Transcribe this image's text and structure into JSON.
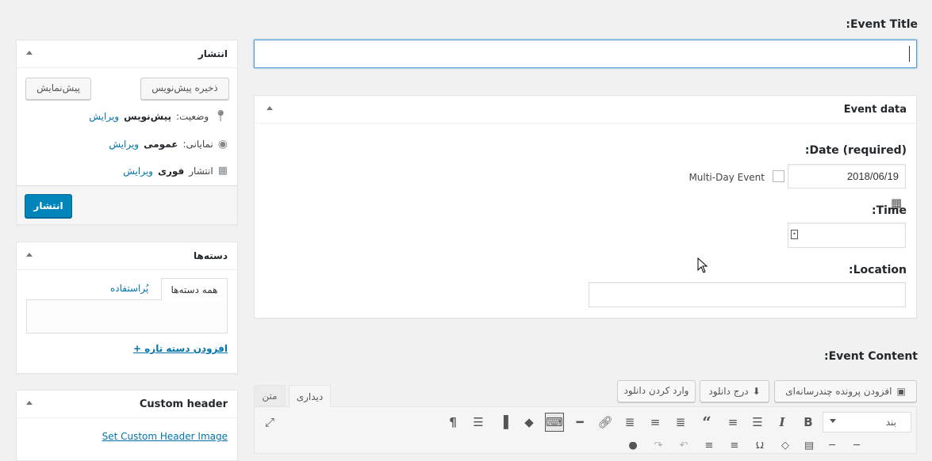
{
  "sidebar": {
    "publish": {
      "title": "انتشار",
      "save_draft_label": "ذخیره پیش‌نویس",
      "preview_label": "پیش‌نمایش",
      "status_label": "وضعیت:",
      "status_value": "پیش‌نویس",
      "visibility_label": "نمایانی:",
      "visibility_value": "عمومی",
      "schedule_label": "انتشار",
      "schedule_value": "فوری",
      "edit_label": "ویرایش",
      "publish_button": "انتشار"
    },
    "categories": {
      "title": "دسته‌ها",
      "tab_all": "همه دسته‌ها",
      "tab_popular": "پُراستفاده",
      "add_new_link": "+ افزودن دسته تازه"
    },
    "custom_header": {
      "title": "Custom header",
      "set_image_link": "Set Custom Header Image"
    }
  },
  "main": {
    "event_title_label": "Event Title:",
    "event_title_value": "",
    "event_data": {
      "title": "Event data",
      "date_label": "Date (required):",
      "date_value": "2018/06/19",
      "multiday_label": "Multi-Day Event",
      "multiday_checked": false,
      "time_label": "Time:",
      "time_value": "",
      "location_label": "Location:",
      "location_value": ""
    },
    "event_content_label": "Event Content:",
    "editor": {
      "add_media_label": "افزودن پرونده چندرسانه‌ای",
      "insert_download_label": "درج دانلود",
      "import_download_label": "وارد کردن دانلود",
      "tab_visual": "دیداری",
      "tab_text": "متن",
      "format_select_value": "بند"
    }
  },
  "icons": {
    "status": "pin-icon",
    "visibility": "eye-icon",
    "schedule": "calendar-icon"
  }
}
